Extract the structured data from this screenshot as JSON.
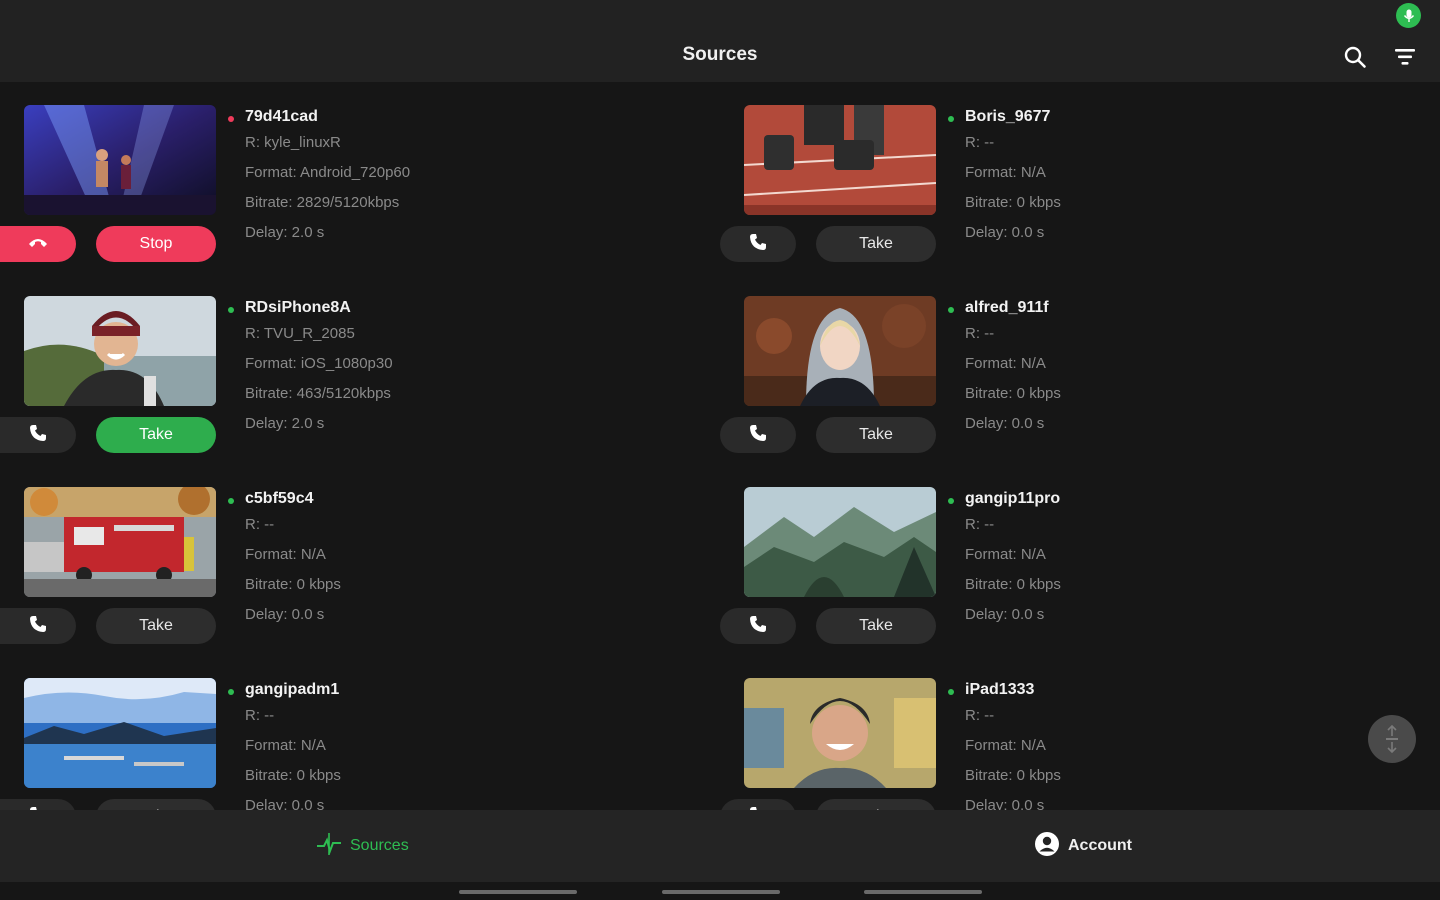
{
  "header": {
    "title": "Sources"
  },
  "actions": {
    "stop_label": "Stop",
    "take_label": "Take"
  },
  "sources": [
    {
      "name": "79d41cad",
      "receiver": "R: kyle_linuxR",
      "format": "Format: Android_720p60",
      "bitrate": "Bitrate: 2829/5120kbps",
      "delay": "Delay: 2.0 s",
      "status_color": "#ef3b5b",
      "state": "live",
      "thumb": "concert"
    },
    {
      "name": "Boris_9677",
      "receiver": "R: --",
      "format": "Format: N/A",
      "bitrate": "Bitrate: 0 kbps",
      "delay": "Delay: 0.0 s",
      "status_color": "#2ebd52",
      "state": "idle",
      "thumb": "track"
    },
    {
      "name": "RDsiPhone8A",
      "receiver": "R: TVU_R_2085",
      "format": "Format: iOS_1080p30",
      "bitrate": "Bitrate: 463/5120kbps",
      "delay": "Delay: 2.0 s",
      "status_color": "#2ebd52",
      "state": "ready",
      "thumb": "selfie-man"
    },
    {
      "name": "alfred_911f",
      "receiver": "R: --",
      "format": "Format: N/A",
      "bitrate": "Bitrate: 0 kbps",
      "delay": "Delay: 0.0 s",
      "status_color": "#2ebd52",
      "state": "idle",
      "thumb": "woman-hood"
    },
    {
      "name": "c5bf59c4",
      "receiver": "R: --",
      "format": "Format: N/A",
      "bitrate": "Bitrate: 0 kbps",
      "delay": "Delay: 0.0 s",
      "status_color": "#2ebd52",
      "state": "idle",
      "thumb": "fire-truck"
    },
    {
      "name": "gangip11pro",
      "receiver": "R: --",
      "format": "Format: N/A",
      "bitrate": "Bitrate: 0 kbps",
      "delay": "Delay: 0.0 s",
      "status_color": "#2ebd52",
      "state": "idle",
      "thumb": "mountains"
    },
    {
      "name": "gangipadm1",
      "receiver": "R: --",
      "format": "Format: N/A",
      "bitrate": "Bitrate: 0 kbps",
      "delay": "Delay: 0.0 s",
      "status_color": "#2ebd52",
      "state": "idle",
      "thumb": "lake"
    },
    {
      "name": "iPad1333",
      "receiver": "R: --",
      "format": "Format: N/A",
      "bitrate": "Bitrate: 0 kbps",
      "delay": "Delay: 0.0 s",
      "status_color": "#2ebd52",
      "state": "idle",
      "thumb": "smiling-man"
    }
  ],
  "nav": {
    "sources_label": "Sources",
    "account_label": "Account"
  },
  "colors": {
    "accent": "#2ebd52",
    "danger": "#ef3b5b",
    "background": "#161616",
    "bar": "#222222"
  }
}
